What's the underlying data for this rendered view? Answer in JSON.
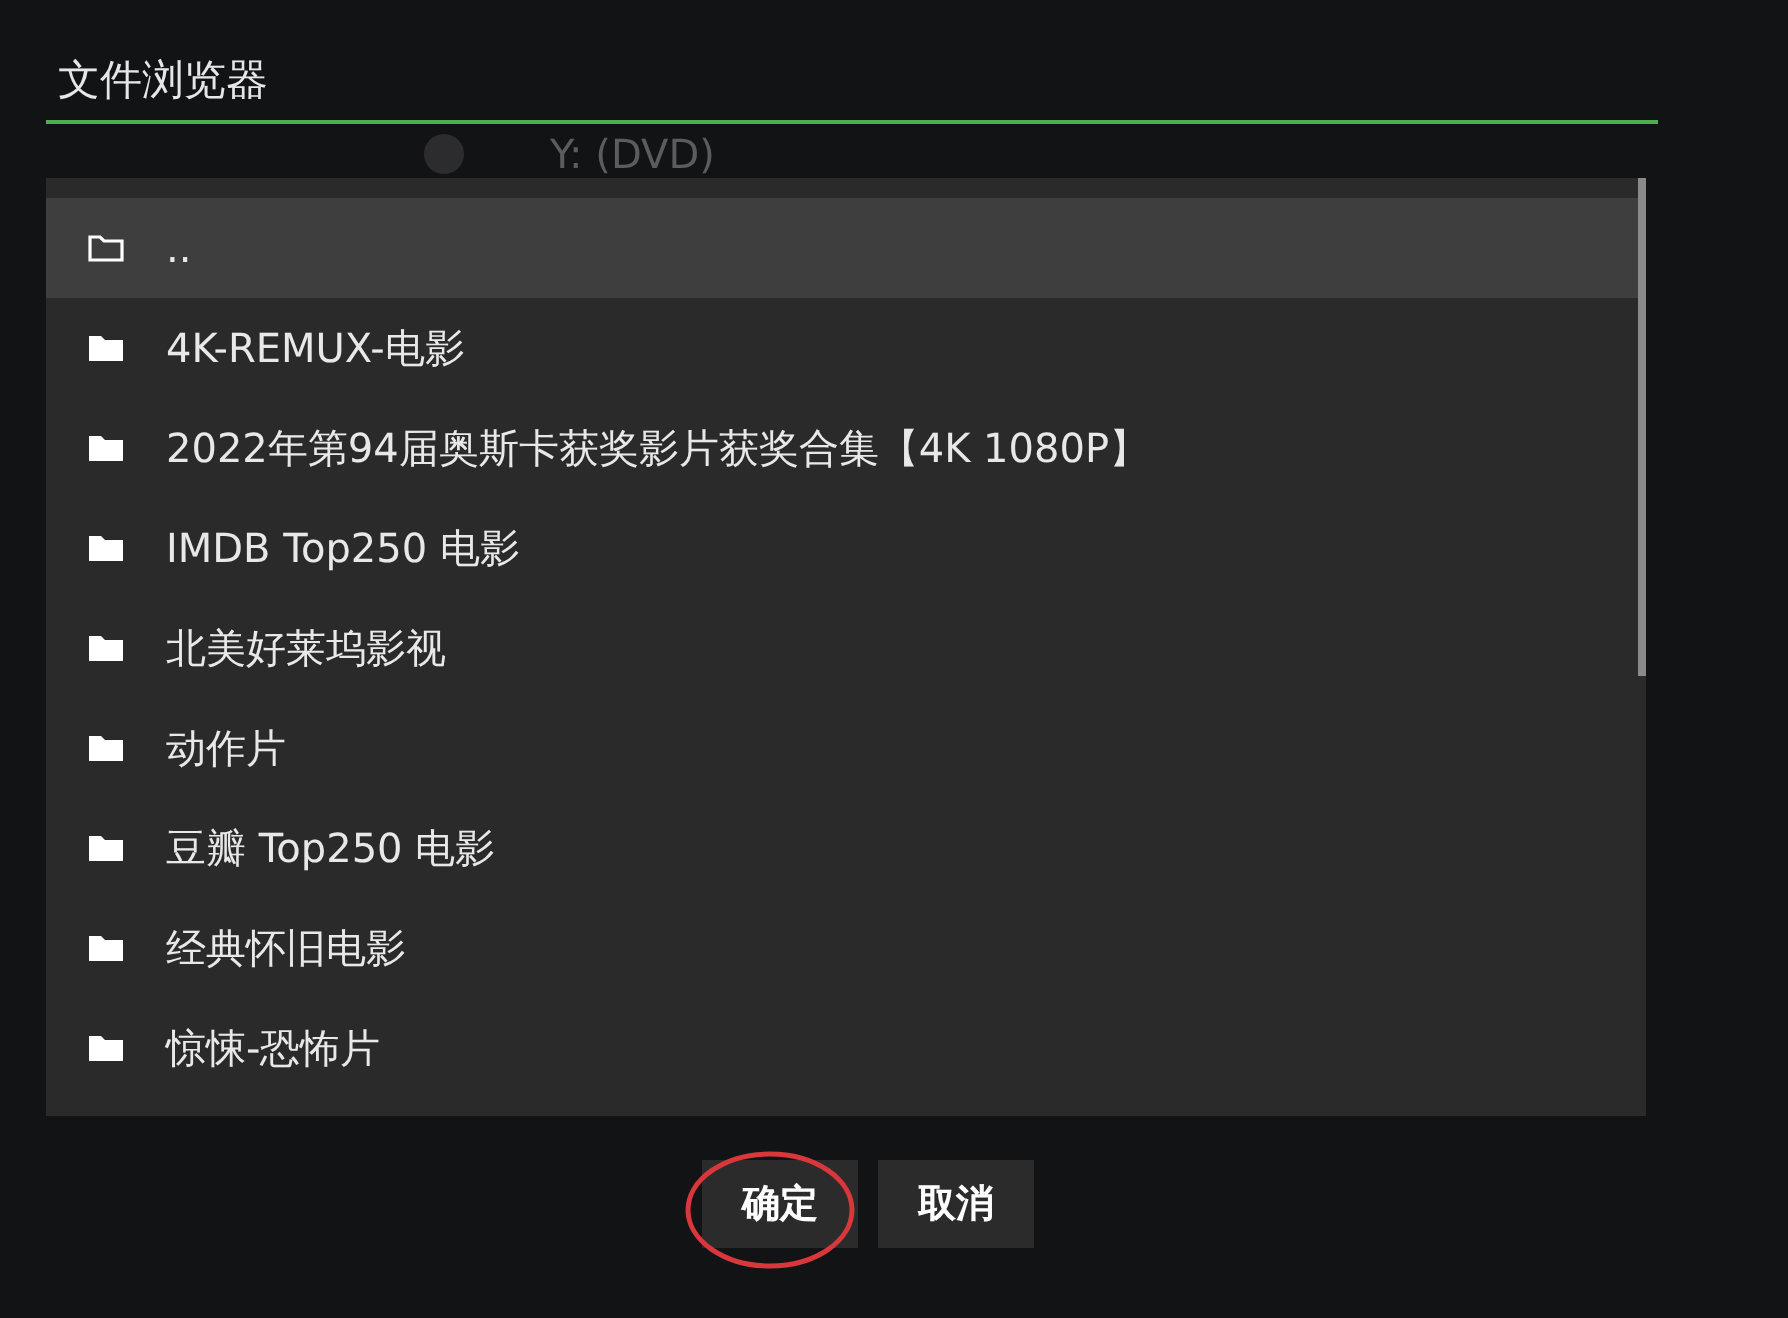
{
  "title": "文件浏览器",
  "background_item": {
    "label": "Y: (DVD)"
  },
  "files": [
    {
      "name": "..",
      "kind": "parent",
      "selected": true
    },
    {
      "name": "4K-REMUX-电影",
      "kind": "folder",
      "selected": false
    },
    {
      "name": "2022年第94届奥斯卡获奖影片获奖合集【4K 1080P】",
      "kind": "folder",
      "selected": false
    },
    {
      "name": "IMDB Top250 电影",
      "kind": "folder",
      "selected": false
    },
    {
      "name": "北美好莱坞影视",
      "kind": "folder",
      "selected": false
    },
    {
      "name": "动作片",
      "kind": "folder",
      "selected": false
    },
    {
      "name": "豆瓣 Top250 电影",
      "kind": "folder",
      "selected": false
    },
    {
      "name": "经典怀旧电影",
      "kind": "folder",
      "selected": false
    },
    {
      "name": "惊悚-恐怖片",
      "kind": "folder",
      "selected": false
    }
  ],
  "buttons": [
    {
      "label": "确定",
      "circled": true
    },
    {
      "label": "取消",
      "circled": false
    }
  ]
}
